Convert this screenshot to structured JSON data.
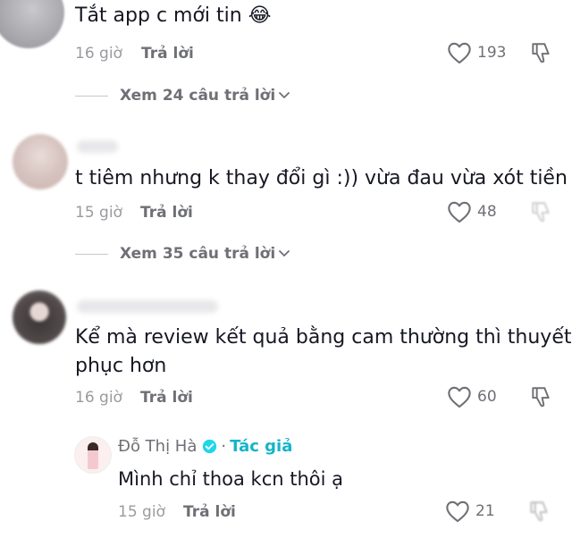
{
  "comments": [
    {
      "text": "Tắt app c mới tin 😂",
      "time": "16 giờ",
      "reply_label": "Trả lời",
      "likes": "193",
      "view_replies": "Xem 24 câu trả lời"
    },
    {
      "text": "t tiêm nhưng k thay đổi gì :)) vừa đau vừa xót tiền",
      "time": "15 giờ",
      "reply_label": "Trả lời",
      "likes": "48",
      "view_replies": "Xem 35 câu trả lời"
    },
    {
      "text_line1": "Kể mà review kết quả bằng cam thường thì thuyết",
      "text_line2": "phục hơn",
      "time": "16 giờ",
      "reply_label": "Trả lời",
      "likes": "60"
    }
  ],
  "author_reply": {
    "name": "Đỗ Thị Hà",
    "separator": "·",
    "tag": "Tác giả",
    "text": "Mình chỉ thoa kcn thôi ạ",
    "time": "15 giờ",
    "reply_label": "Trả lời",
    "likes": "21"
  },
  "icons": {
    "like": "heart-outline-icon",
    "dislike": "thumbs-down-icon",
    "expand": "chevron-down-icon",
    "verified": "verified-badge-icon"
  },
  "colors": {
    "text": "#161823",
    "muted": "#9a9ba0",
    "secondary": "#6f7075",
    "author_tag": "#13b5c9"
  }
}
